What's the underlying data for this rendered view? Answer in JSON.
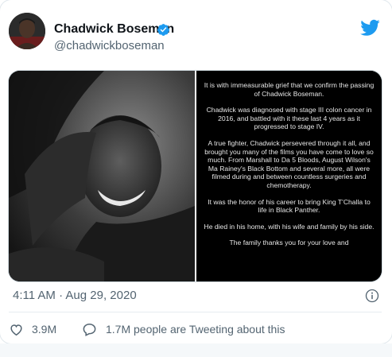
{
  "tweet": {
    "display_name": "Chadwick Boseman",
    "handle": "@chadwickboseman",
    "timestamp": "4:11 AM · Aug 29, 2020",
    "likes": "3.9M",
    "talking": "1.7M people are Tweeting about this"
  },
  "statement": {
    "paragraphs": [
      "It is with immeasurable grief that we confirm the passing of Chadwick Boseman.",
      "Chadwick was diagnosed with stage III colon cancer in 2016, and battled with it these last 4 years as it progressed to stage IV.",
      "A true fighter, Chadwick persevered through it all, and brought you many of the films you have come to love so much. From Marshall to Da 5 Bloods, August Wilson's Ma Rainey's Black Bottom and several more, all were filmed during and between countless surgeries and chemotherapy.",
      "It was the honor of his career to bring King T'Challa to life in Black Panther.",
      "He died in his home, with his wife and family by his side.",
      "The family thanks you for your love and"
    ]
  },
  "colors": {
    "brand": "#1d9bf0",
    "text_primary": "#0f1419",
    "text_secondary": "#536471"
  },
  "icons": {
    "verified": "verified-badge-icon",
    "logo": "twitter-bird-icon",
    "info": "info-icon",
    "like": "heart-icon",
    "conversation": "speech-bubble-icon"
  }
}
